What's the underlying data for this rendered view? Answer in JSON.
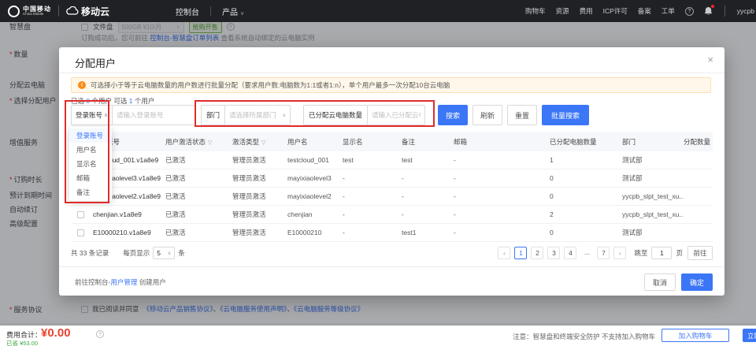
{
  "colors": {
    "accent_blue": "#3B76F6",
    "annotation_red": "#E12B2B",
    "price_red": "#E8422F",
    "saved_green": "#3DA742",
    "badge_green": "#56A832",
    "banner_orange": "#FA8C16",
    "nav_dark": "#1F2125"
  },
  "topnav": {
    "logo_cn": "中国移动",
    "logo_en": "China Mobile",
    "logo_product": "移动云",
    "console_label": "控制台",
    "product_label": "产品",
    "right_items": [
      "购物车",
      "资源",
      "费用",
      "ICP许可",
      "备案",
      "工单"
    ],
    "help_icon": "?",
    "username": "yycpb"
  },
  "background": {
    "form_labels": [
      {
        "text": "智慧盘",
        "required": false
      },
      {
        "text": "数量",
        "required": true
      },
      {
        "text": "分配云电脑",
        "required": false
      },
      {
        "text": "选择分配用户",
        "required": true
      },
      {
        "text": "增值服务",
        "required": false
      },
      {
        "text": "订购时长",
        "required": true
      },
      {
        "text": "预计到期时间",
        "required": false
      },
      {
        "text": "自动续订",
        "required": false
      },
      {
        "text": "高级配置",
        "required": false
      },
      {
        "text": "服务协议",
        "required": true
      }
    ],
    "file_disk_checkbox": "文件盘",
    "disk_select_value": "500GB  ¥10/月",
    "sale_badge": "抢购开售",
    "order_hint_prefix": "订购成功后，您可前往 ",
    "order_hint_link": "控制台-智慧盘订单列表",
    "order_hint_suffix": " 查看系统自动绑定的云电脑实例",
    "agreement_prefix": "我已阅读并同意",
    "agreement_links": [
      "《移动云产品销售协议》",
      "《云电脑服务使用声明》",
      "《云电脑服务等级协议》"
    ],
    "agreement_separator": "、"
  },
  "modal": {
    "title": "分配用户",
    "close_icon": "×",
    "banner_text": "可选择小于等于云电脑数量的用户数进行批量分配（要求用户数:电脑数为1:1或者1:n），单个用户最多一次分配10台云电脑",
    "selection": {
      "prefix": "已选",
      "selected_count": "0",
      "middle": "个用户 可选",
      "available_count": "1",
      "suffix": "个用户"
    },
    "filters": {
      "field_selected": "登录账号",
      "field_options": [
        "登录账号",
        "用户名",
        "显示名",
        "邮箱",
        "备注"
      ],
      "keyword_placeholder": "请输入登录账号",
      "dept_label": "部门",
      "dept_placeholder": "请选择所属部门",
      "assigned_label": "已分配云电脑数量",
      "assigned_placeholder": "请输入已分配云电脑数量",
      "search_button": "搜索",
      "refresh_button": "刷新",
      "reset_button": "重置",
      "batch_search_button": "批量搜索"
    },
    "table": {
      "filter_icon": "▽",
      "headers": [
        {
          "label": "登录账号",
          "filter": false
        },
        {
          "label": "用户激活状态",
          "filter": true
        },
        {
          "label": "激活类型",
          "filter": true
        },
        {
          "label": "用户名",
          "filter": false
        },
        {
          "label": "显示名",
          "filter": false
        },
        {
          "label": "备注",
          "filter": false
        },
        {
          "label": "邮箱",
          "filter": false
        },
        {
          "label": "已分配电脑数量",
          "filter": false
        },
        {
          "label": "部门",
          "filter": false
        },
        {
          "label": "分配数量",
          "filter": false
        }
      ],
      "rows": [
        {
          "account": "testcloud_001.v1a8e9",
          "status": "已激活",
          "type": "管理员激活",
          "username": "testcloud_001",
          "display": "test",
          "remark": "test",
          "email": "-",
          "assigned": "1",
          "dept": "测试部",
          "qty": ""
        },
        {
          "account": "mayixiaolevel3.v1a8e9",
          "status": "已激活",
          "type": "管理员激活",
          "username": "mayixiaolevel3",
          "display": "-",
          "remark": "-",
          "email": "-",
          "assigned": "0",
          "dept": "测试部",
          "qty": ""
        },
        {
          "account": "mayixiaolevel2.v1a8e9",
          "status": "已激活",
          "type": "管理员激活",
          "username": "mayixiaolevel2",
          "display": "-",
          "remark": "-",
          "email": "-",
          "assigned": "0",
          "dept": "yycpb_slpt_test_xu...",
          "qty": ""
        },
        {
          "account": "chenjian.v1a8e9",
          "status": "已激活",
          "type": "管理员激活",
          "username": "chenjian",
          "display": "-",
          "remark": "-",
          "email": "-",
          "assigned": "2",
          "dept": "yycpb_slpt_test_xu...",
          "qty": ""
        },
        {
          "account": "E10000210.v1a8e9",
          "status": "已激活",
          "type": "管理员激活",
          "username": "E10000210",
          "display": "-",
          "remark": "test1",
          "email": "-",
          "assigned": "0",
          "dept": "测试部",
          "qty": ""
        }
      ]
    },
    "pagination": {
      "total_prefix": "共",
      "total_count": "33",
      "total_suffix": "条记录",
      "per_page_label": "每页显示",
      "per_page_value": "5",
      "per_page_unit": "条",
      "prev_icon": "‹",
      "next_icon": "›",
      "pages": [
        "1",
        "2",
        "3",
        "4",
        "...",
        "7"
      ],
      "active_page": "1",
      "jump_label": "跳至",
      "jump_value": "1",
      "jump_unit": "页",
      "go_button": "前往"
    },
    "footer": {
      "hint_prefix": "前往控制台-",
      "hint_link": "用户管理",
      "hint_suffix": " 创建用户",
      "cancel_button": "取消",
      "confirm_button": "确定"
    }
  },
  "bottom_bar": {
    "total_label": "费用合计：",
    "total_value": "¥0.00",
    "saved_text": "已省 ¥53.00",
    "notice": "注意：智慧盘和终端安全防护 不支持加入购物车",
    "add_cart_button": "加入购物车",
    "buy_button": "立即购买"
  }
}
